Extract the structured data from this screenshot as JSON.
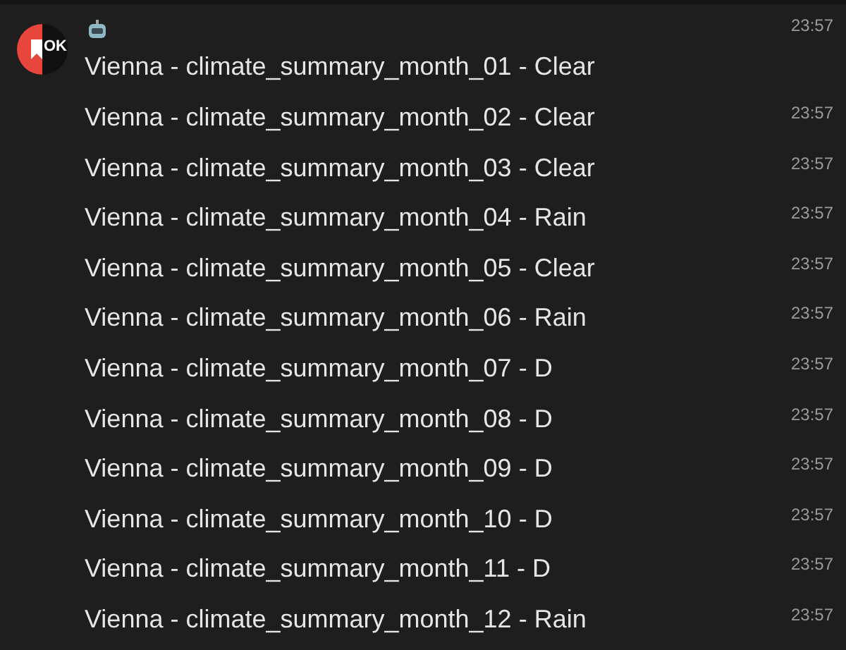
{
  "sender": {
    "avatar_text": "OK"
  },
  "messages": [
    {
      "text": "Vienna - climate_summary_month_01 - Clear",
      "time": "23:57"
    },
    {
      "text": "Vienna - climate_summary_month_02 - Clear",
      "time": "23:57"
    },
    {
      "text": "Vienna - climate_summary_month_03 - Clear",
      "time": "23:57"
    },
    {
      "text": "Vienna - climate_summary_month_04 - Rain",
      "time": "23:57"
    },
    {
      "text": "Vienna - climate_summary_month_05 - Clear",
      "time": "23:57"
    },
    {
      "text": "Vienna - climate_summary_month_06 - Rain",
      "time": "23:57"
    },
    {
      "text": "Vienna - climate_summary_month_07 - D",
      "time": "23:57"
    },
    {
      "text": "Vienna - climate_summary_month_08 - D",
      "time": "23:57"
    },
    {
      "text": "Vienna - climate_summary_month_09 - D",
      "time": "23:57"
    },
    {
      "text": "Vienna - climate_summary_month_10 - D",
      "time": "23:57"
    },
    {
      "text": "Vienna - climate_summary_month_11 - D",
      "time": "23:57"
    },
    {
      "text": "Vienna - climate_summary_month_12 - Rain",
      "time": "23:57"
    }
  ]
}
